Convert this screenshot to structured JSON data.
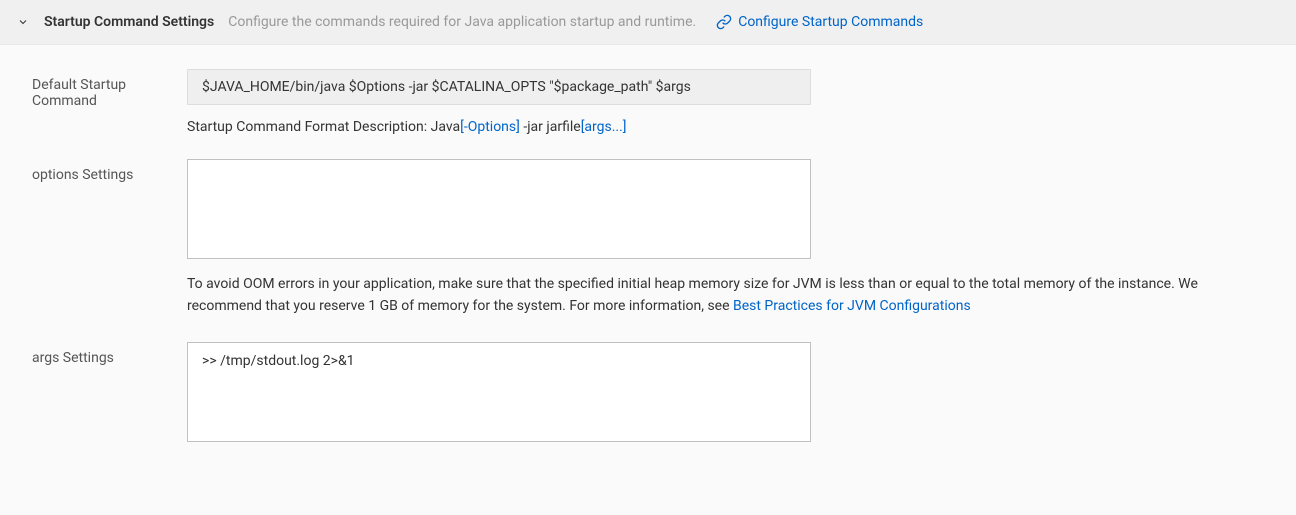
{
  "header": {
    "title": "Startup Command Settings",
    "description": "Configure the commands required for Java application startup and runtime.",
    "config_link_label": "Configure Startup Commands"
  },
  "defaultStartup": {
    "label": "Default Startup Command",
    "value": "$JAVA_HOME/bin/java $Options -jar $CATALINA_OPTS \"$package_path\" $args",
    "format_prefix": "Startup Command Format Description: Java",
    "format_options": "[-Options]",
    "format_mid": " -jar jarfile",
    "format_args": "[args...]"
  },
  "optionsSettings": {
    "label": "options Settings",
    "value": "",
    "helper_prefix": "To avoid OOM errors in your application, make sure that the specified initial heap memory size for JVM is less than or equal to the total memory of the instance. We recommend that you reserve 1 GB of memory for the system. For more information, see ",
    "helper_link": "Best Practices for JVM Configurations"
  },
  "argsSettings": {
    "label": "args Settings",
    "value": ">> /tmp/stdout.log 2>&1"
  }
}
